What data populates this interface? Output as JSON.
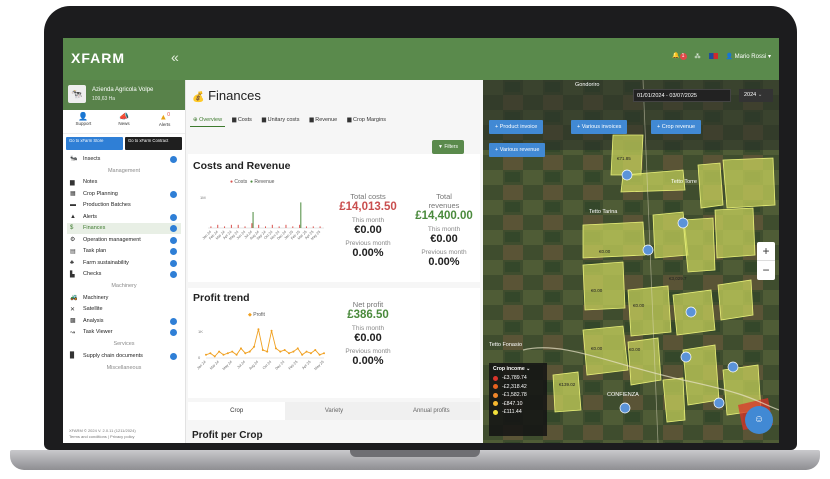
{
  "topbar": {
    "logo": "XFARM",
    "collapse_icon": "«",
    "notif_count": "1",
    "user_name": "Mario Rossi ▾"
  },
  "sidebar": {
    "farm_name": "Azienda Agricola Volpe",
    "farm_area": "109,63 Ha",
    "quick": [
      {
        "label": "Support",
        "icon": "support-icon"
      },
      {
        "label": "News",
        "icon": "megaphone-icon"
      },
      {
        "label": "Alerts",
        "icon": "alert-icon",
        "badge": "0"
      }
    ],
    "stores": [
      {
        "label": "Go to xFarm Store",
        "color": "#2f7fd6"
      },
      {
        "label": "Go to xFarm Contract",
        "color": "#1f1f1f"
      }
    ],
    "items_top": [
      {
        "label": "Insects",
        "badge": true
      }
    ],
    "section_management": "Management",
    "items_management": [
      {
        "label": "Notes",
        "badge": false
      },
      {
        "label": "Crop Planning",
        "badge": true
      },
      {
        "label": "Production Batches",
        "badge": false
      },
      {
        "label": "Alerts",
        "badge": true
      },
      {
        "label": "Finances",
        "badge": true,
        "active": true
      },
      {
        "label": "Operation management",
        "badge": true
      },
      {
        "label": "Task plan",
        "badge": true
      },
      {
        "label": "Farm sustainability",
        "badge": true
      },
      {
        "label": "Checks",
        "badge": true
      }
    ],
    "section_machinery": "Machinery",
    "items_machinery": [
      {
        "label": "Machinery",
        "badge": false
      },
      {
        "label": "Satellite",
        "badge": false
      },
      {
        "label": "Analysis",
        "badge": true
      },
      {
        "label": "Task Viewer",
        "badge": true
      }
    ],
    "section_services": "Services",
    "items_services": [
      {
        "label": "Supply chain documents",
        "badge": true
      }
    ],
    "section_misc": "Miscellaneous",
    "footer_line1": "XFARM © 2024 V. 2.0.11 (1211/2024)",
    "footer_line2": "Terms and conditions | Privacy policy"
  },
  "main": {
    "title": "Finances",
    "tabs": [
      "Overview",
      "Costs",
      "Unitary costs",
      "Revenue",
      "Crop Margins"
    ],
    "filters_label": "Filters",
    "costs_revenue": {
      "title": "Costs and Revenue",
      "legend_costs": "Costs",
      "legend_revenue": "Revenue",
      "total_costs_label": "Total costs",
      "total_costs": "£14,013.50",
      "total_revenues_label": "Total revenues",
      "total_revenues": "£14,400.00",
      "this_month_label": "This month",
      "costs_this_month": "€0.00",
      "revenues_this_month": "€0.00",
      "previous_month_label": "Previous month",
      "costs_prev_month": "0.00%",
      "revenues_prev_month": "0.00%",
      "y_tick": "1M",
      "x_ticks": [
        "Jan 24",
        "Feb 24",
        "Mar 24",
        "Apr 24",
        "May 24",
        "Jun 24",
        "Jul 24",
        "Aug 24",
        "Sep 24",
        "Oct 24",
        "Nov 24",
        "Dec 24",
        "Jan 25",
        "Feb 25",
        "Mar 25",
        "Apr 25",
        "May 25"
      ]
    },
    "profit_trend": {
      "title": "Profit trend",
      "legend": "Profit",
      "net_profit_label": "Net profit",
      "net_profit": "£386.50",
      "this_month_label": "This month",
      "this_month": "€0.00",
      "previous_month_label": "Previous month",
      "previous_month": "0.00%",
      "y_ticks": [
        "1K",
        "0"
      ],
      "x_ticks": [
        "Jan 24",
        "Mar 24",
        "May 24",
        "Jul 24",
        "Aug 24",
        "Oct 24",
        "Dec 24",
        "Feb 25",
        "Apr 25",
        "May 25"
      ]
    },
    "bottom_tabs": [
      "Crop",
      "Variety",
      "Annual profits"
    ],
    "profit_per_crop_title": "Profit per Crop"
  },
  "map": {
    "date_range": "01/01/2024 - 03/07/2025",
    "year": "2024",
    "buttons": [
      "+ Product invoice",
      "+ Various invoices",
      "+ Crop revenue",
      "+ Various revenue"
    ],
    "place_labels": [
      "Gondoriro",
      "Tetto Torre",
      "Tetto Tarina",
      "Tetto Fonasio",
      "CONFIENZA"
    ],
    "field_labels": [
      "€71.85",
      "€0.00",
      "€0.00",
      "€0.00",
      "€3,029.7",
      "€0.00",
      "€139.02",
      "€0.00"
    ],
    "legend": {
      "title": "Crop income ⌄",
      "items": [
        {
          "label": "-£3,789.74",
          "color": "#d9342b"
        },
        {
          "label": "-£2,318.42",
          "color": "#e8621f"
        },
        {
          "label": "-£1,582.78",
          "color": "#f0872a"
        },
        {
          "label": "-£847.10",
          "color": "#f5b72f"
        },
        {
          "label": "-£111.44",
          "color": "#f2e03b"
        }
      ]
    }
  },
  "chart_data": [
    {
      "type": "bar",
      "title": "Costs and Revenue",
      "categories": [
        "Jan 24",
        "Feb 24",
        "Mar 24",
        "Apr 24",
        "May 24",
        "Jun 24",
        "Jul 24",
        "Aug 24",
        "Sep 24",
        "Oct 24",
        "Nov 24",
        "Dec 24",
        "Jan 25",
        "Feb 25",
        "Mar 25",
        "Apr 25",
        "May 25"
      ],
      "series": [
        {
          "name": "Costs",
          "color": "#d9534f",
          "values": [
            0.05,
            0.1,
            0.05,
            0.1,
            0.1,
            0.05,
            0.15,
            0.1,
            0.05,
            0.1,
            0.05,
            0.1,
            0.05,
            0.1,
            0.05,
            0.05,
            0.05
          ]
        },
        {
          "name": "Revenue",
          "color": "#4a8a3c",
          "values": [
            0,
            0,
            0,
            0,
            0,
            0,
            0.5,
            0,
            0,
            0,
            0,
            0,
            0,
            0.8,
            0,
            0,
            0
          ]
        }
      ]
    },
    {
      "type": "line",
      "title": "Profit trend",
      "series": [
        {
          "name": "Profit",
          "color": "#f0a020",
          "values": [
            0.1,
            0.15,
            0.05,
            0.2,
            0.1,
            0.15,
            0.2,
            0.1,
            0.3,
            0.15,
            0.2,
            0.35,
            0.9,
            0.25,
            0.2,
            0.85,
            0.3,
            0.2,
            0.25,
            0.15,
            0.2,
            0.3,
            0.1,
            0.2,
            0.15,
            0.25,
            0.1,
            0.15
          ]
        }
      ]
    }
  ]
}
